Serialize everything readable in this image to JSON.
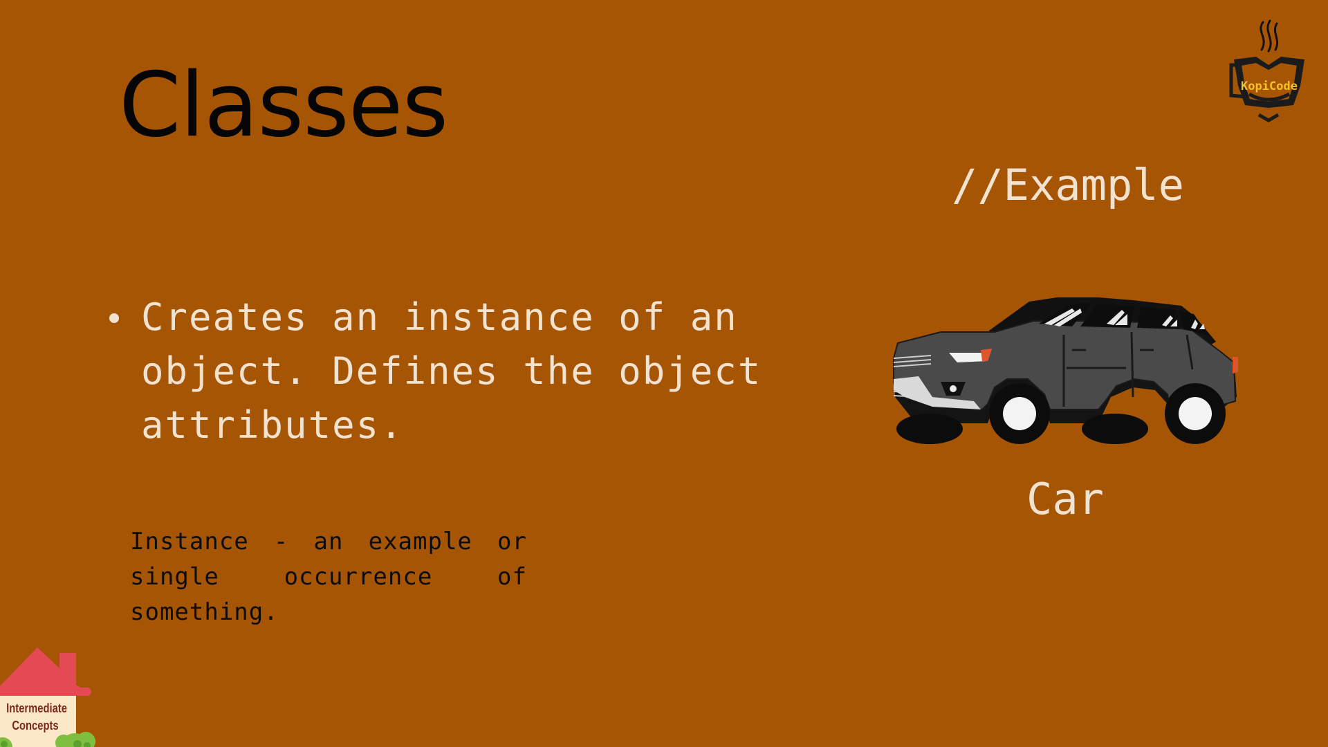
{
  "slide": {
    "title": "Classes",
    "example_label": "//Example",
    "bullets": [
      "Creates an instance of an object. Defines the object attributes."
    ],
    "definition": "Instance - an example or single occurrence of something.",
    "car_caption": "Car"
  },
  "logo": {
    "text": "KopiCode",
    "icon": "coffee-cup-icon"
  },
  "badge": {
    "text": "Intermediate Concepts",
    "icon": "house-icon"
  },
  "colors": {
    "background": "#a65504",
    "light_text": "#f1e3cf",
    "dark_text": "#050505",
    "logo_text": "#f6c12a"
  }
}
